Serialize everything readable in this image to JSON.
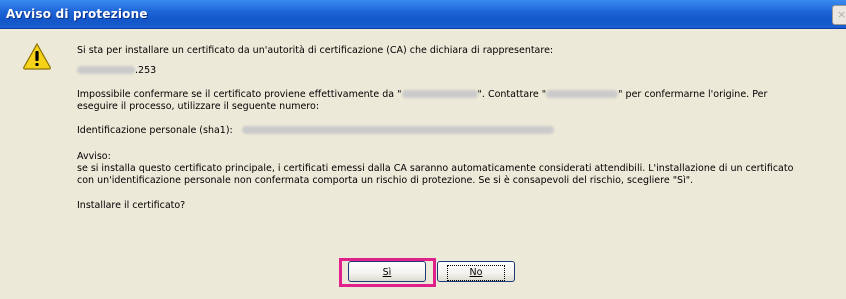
{
  "window": {
    "title": "Avviso di protezione",
    "close_glyph": "×"
  },
  "icon": {
    "name": "warning-icon",
    "color": "#f6d21a"
  },
  "message": {
    "line1": "Si sta per installare un certificato da un'autorità di certificazione (CA) che dichiara di rappresentare:",
    "host_suffix": ".253",
    "line3a_start": "Impossibile confermare se il certificato proviene effettivamente da \"",
    "line3a_mid": "\". Contattare \"",
    "line3a_end": "\" per confermarne l'origine. Per",
    "line3b": "eseguire il processo, utilizzare il seguente numero:",
    "thumbprint_label": "Identificazione personale (sha1):",
    "warning_heading": "Avviso:",
    "warning_line1": "se si installa questo certificato principale, i certificati emessi dalla CA saranno automaticamente considerati attendibili. L'installazione di un certificato",
    "warning_line2": "con un'identificazione personale non confermata comporta un rischio di protezione. Se si è consapevoli del rischio, scegliere \"Sì\".",
    "question": "Installare il certificato?"
  },
  "buttons": {
    "yes_label": "Sì",
    "no_label": "No"
  },
  "colors": {
    "titlebar": "#1f66d9",
    "highlight": "#e0218c",
    "dialog_bg": "#ece9d8"
  }
}
